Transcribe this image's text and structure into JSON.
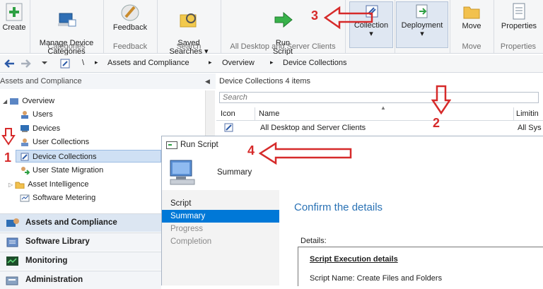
{
  "ribbon": {
    "groups": {
      "create": {
        "label": "Create"
      },
      "categories": {
        "button": "Manage Device\nCategories",
        "label": "Categories"
      },
      "feedback": {
        "button": "Feedback",
        "label": "Feedback"
      },
      "search": {
        "button": "Saved\nSearches ▾",
        "label": "Search"
      },
      "runscript": {
        "button": "Run\nScript",
        "label": "All Desktop and Server Clients"
      },
      "collection": {
        "button": "Collection",
        "caret": "▾"
      },
      "deployment": {
        "button": "Deployment",
        "caret": "▾"
      },
      "move": {
        "button": "Move",
        "label": "Move"
      },
      "properties": {
        "button": "Properties",
        "label": "Properties"
      }
    }
  },
  "addressbar": {
    "sep": "\\",
    "crumbs": [
      "Assets and Compliance",
      "Overview",
      "Device Collections"
    ]
  },
  "nav": {
    "title": "Assets and Compliance",
    "items": [
      {
        "label": "Overview"
      },
      {
        "label": "Users"
      },
      {
        "label": "Devices"
      },
      {
        "label": "User Collections"
      },
      {
        "label": "Device Collections"
      },
      {
        "label": "User State Migration"
      },
      {
        "label": "Asset Intelligence"
      },
      {
        "label": "Software Metering"
      }
    ],
    "workspaces": [
      {
        "label": "Assets and Compliance"
      },
      {
        "label": "Software Library"
      },
      {
        "label": "Monitoring"
      },
      {
        "label": "Administration"
      }
    ]
  },
  "list": {
    "title": "Device Collections 4 items",
    "search_placeholder": "Search",
    "columns": {
      "icon": "Icon",
      "name": "Name",
      "limiting": "Limitin"
    },
    "rows": [
      {
        "name": "All Desktop and Server Clients",
        "limiting": "All Sys"
      }
    ]
  },
  "dialog": {
    "title": "Run Script",
    "header": "Summary",
    "steps": [
      {
        "label": "Script",
        "state": "dim"
      },
      {
        "label": "Summary",
        "state": "active"
      },
      {
        "label": "Progress",
        "state": "dim"
      },
      {
        "label": "Completion",
        "state": "dim"
      }
    ],
    "heading": "Confirm the details",
    "details_label": "Details:",
    "details_heading": "Script Execution details",
    "details_line": "Script Name: Create Files and Folders"
  },
  "callouts": [
    "1",
    "2",
    "3",
    "4"
  ],
  "colors": {
    "accent": "#0078d7",
    "callout": "#d62a2a",
    "heading": "#2a72b5"
  }
}
